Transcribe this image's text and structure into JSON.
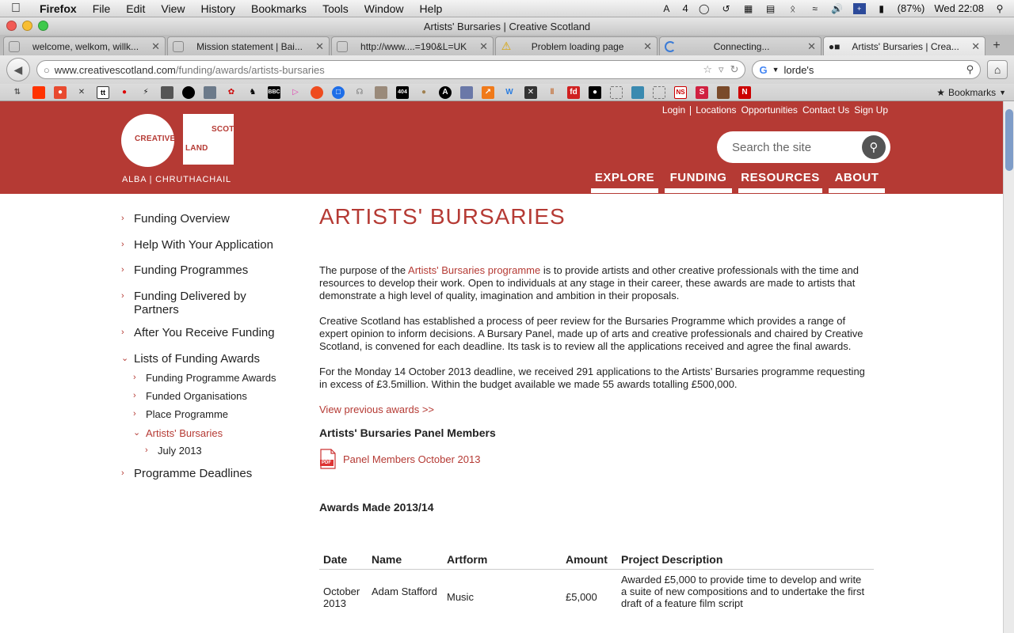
{
  "os_menu": {
    "app": "Firefox",
    "items": [
      "File",
      "Edit",
      "View",
      "History",
      "Bookmarks",
      "Tools",
      "Window",
      "Help"
    ],
    "status_text": "4",
    "battery": "(87%)",
    "clock": "Wed 22:08"
  },
  "window": {
    "title": "Artists' Bursaries | Creative Scotland"
  },
  "tabs": [
    {
      "label": "welcome, welkom, willk...",
      "active": false
    },
    {
      "label": "Mission statement | Bai...",
      "active": false
    },
    {
      "label": "http://www....=190&L=UK",
      "active": false
    },
    {
      "label": "Problem loading page",
      "active": false
    },
    {
      "label": "Connecting...",
      "active": false
    },
    {
      "label": "Artists' Bursaries | Crea...",
      "active": true
    }
  ],
  "nav": {
    "url_host": "www.creativescotland.com",
    "url_path": "/funding/awards/artists-bursaries",
    "search_value": "lorde's",
    "bookmarks_label": "Bookmarks"
  },
  "site": {
    "logo": {
      "word1": "CREATIVE",
      "word2": "SCOT",
      "word3": "LAND",
      "tagline": "ALBA | CHRUTHACHAIL"
    },
    "top_links": [
      "Login",
      "Locations",
      "Opportunities",
      "Contact Us",
      "Sign Up"
    ],
    "search_placeholder": "Search the site",
    "main_nav": [
      "EXPLORE",
      "FUNDING",
      "RESOURCES",
      "ABOUT"
    ]
  },
  "sidebar": {
    "items": [
      "Funding Overview",
      "Help With Your Application",
      "Funding Programmes",
      "Funding Delivered by Partners",
      "After You Receive Funding",
      "Lists of Funding Awards"
    ],
    "sub_items": [
      "Funding Programme Awards",
      "Funded Organisations",
      "Place Programme",
      "Artists' Bursaries"
    ],
    "sub_sub_item": "July 2013",
    "last_item": "Programme Deadlines"
  },
  "content": {
    "title": "ARTISTS' BURSARIES",
    "p1_before": "The purpose of the ",
    "p1_link": "Artists' Bursaries programme",
    "p1_after": " is to provide artists and other creative professionals with the time and resources to develop their work. Open to individuals at any stage in their career, these awards are made to artists that demonstrate a high level of quality, imagination and ambition in their proposals.",
    "p2": "Creative Scotland has established a process of peer review for the Bursaries Programme which provides a range of expert opinion to inform decisions. A Bursary Panel, made up of arts and creative professionals and chaired by Creative Scotland, is convened for each deadline. Its task is to review all the applications received and agree the final awards.",
    "p3": "For the Monday 14 October 2013 deadline, we received 291 applications to the Artists’ Bursaries programme requesting in excess of £3.5million. Within the budget available we made 55 awards totalling £500,000.",
    "view_previous": "View previous awards >>",
    "panel_heading": "Artists' Bursaries Panel Members",
    "panel_link": "Panel Members October 2013",
    "pdf_label": "PDF",
    "awards_heading": "Awards Made 2013/14",
    "table": {
      "headers": [
        "Date",
        "Name",
        "Artform",
        "Amount",
        "Project Description"
      ],
      "row1": {
        "date": "October 2013",
        "name": "Adam Stafford",
        "artform": "Music",
        "amount": "£5,000",
        "desc": "Awarded £5,000 to provide time to develop and write a suite of new compositions and to undertake the first draft of a feature film script"
      }
    }
  },
  "colors": {
    "brand": "#b53a34",
    "search_button": "#545454"
  }
}
